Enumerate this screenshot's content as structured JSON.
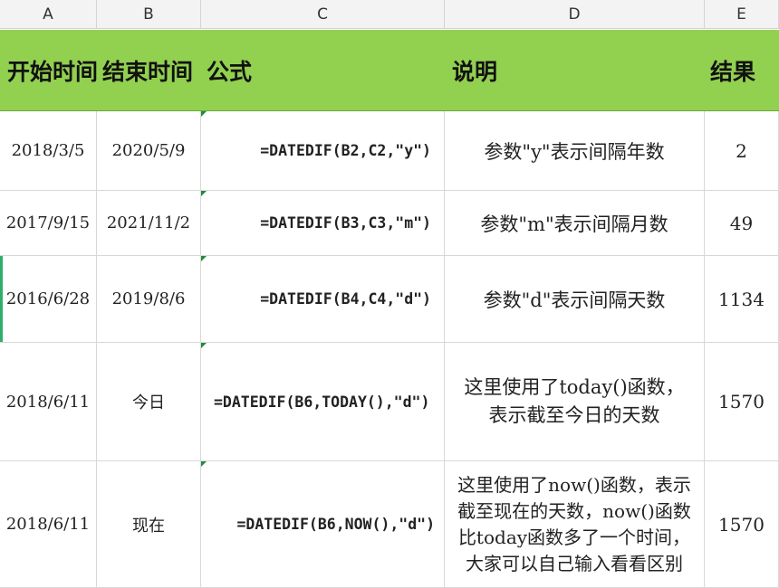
{
  "columns": [
    "A",
    "B",
    "C",
    "D",
    "E"
  ],
  "header": {
    "start": "开始时间",
    "end": "结束时间",
    "formula": "公式",
    "desc": "说明",
    "result": "结果"
  },
  "rows": [
    {
      "start": "2018/3/5",
      "end": "2020/5/9",
      "formula": "=DATEDIF(B2,C2,\"y\")",
      "desc": [
        "参数\"y\"表示间隔年数"
      ],
      "result": "2"
    },
    {
      "start": "2017/9/15",
      "end": "2021/11/2",
      "formula": "=DATEDIF(B3,C3,\"m\")",
      "desc": [
        "参数\"m\"表示间隔月数"
      ],
      "result": "49"
    },
    {
      "start": "2016/6/28",
      "end": "2019/8/6",
      "formula": "=DATEDIF(B4,C4,\"d\")",
      "desc": [
        "参数\"d\"表示间隔天数"
      ],
      "result": "1134"
    },
    {
      "start": "2018/6/11",
      "end": "今日",
      "formula": "=DATEDIF(B6,TODAY(),\"d\")",
      "desc": [
        "这里使用了today()函数，",
        "表示截至今日的天数"
      ],
      "result": "1570"
    },
    {
      "start": "2018/6/11",
      "end": "现在",
      "formula": "=DATEDIF(B6,NOW(),\"d\")",
      "desc": [
        "这里使用了now()函数，表示",
        "截至现在的天数，now()函数",
        "比today函数多了一个时间，",
        "大家可以自己输入看看区别"
      ],
      "result": "1570"
    }
  ],
  "colors": {
    "header_bg": "#92d050",
    "grid": "#d8d8d8",
    "comment_marker": "#1e8c3a"
  }
}
